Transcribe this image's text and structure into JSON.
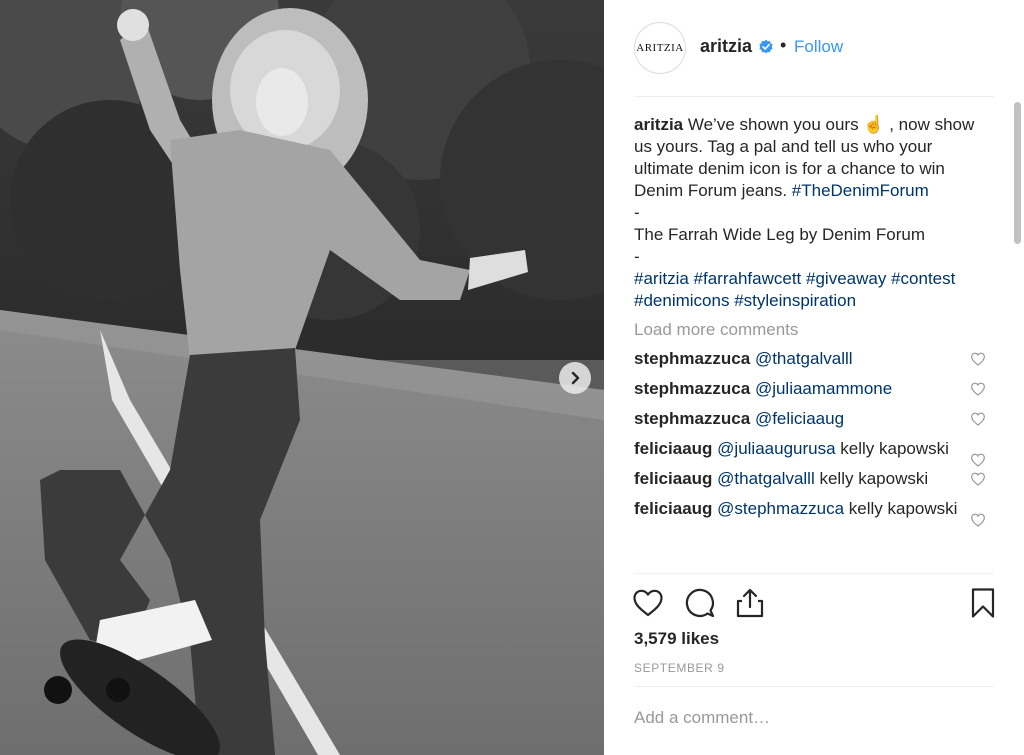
{
  "post": {
    "account": {
      "avatar_text": "ARITZIA",
      "handle": "aritzia",
      "verified_icon": "verified-badge-icon",
      "separator": "•",
      "follow_label": "Follow"
    },
    "caption": {
      "user": "aritzia",
      "line1": " We’ve shown you ours ",
      "emoji": "☝️",
      "line1_end": " , now show us yours. Tag a pal and tell us who your ultimate denim icon is for a chance to win Denim Forum jeans. ",
      "tag1": "#TheDenimForum",
      "dash1": "-",
      "product": "The Farrah Wide Leg by Denim Forum",
      "dash2": "-",
      "tags": [
        "#aritzia",
        "#farrahfawcett",
        "#giveaway",
        "#contest",
        "#denimicons",
        "#styleinspiration"
      ]
    },
    "load_more_label": "Load more comments",
    "comments": [
      {
        "user": "stephmazzuca",
        "mention": "@thatgalvalll",
        "text": ""
      },
      {
        "user": "stephmazzuca",
        "mention": "@juliaamammone",
        "text": ""
      },
      {
        "user": "stephmazzuca",
        "mention": "@feliciaaug",
        "text": ""
      },
      {
        "user": "feliciaaug",
        "mention": "@juliaaugurusa",
        "text": " kelly kapowski"
      },
      {
        "user": "feliciaaug",
        "mention": "@thatgalvalll",
        "text": " kelly kapowski"
      },
      {
        "user": "feliciaaug",
        "mention": "@stephmazzuca",
        "text": " kelly kapowski"
      }
    ],
    "actions": {
      "like_icon": "heart-icon",
      "comment_icon": "comment-icon",
      "share_icon": "share-icon",
      "save_icon": "bookmark-icon"
    },
    "likes": "3,579 likes",
    "date": "SEPTEMBER 9",
    "add_comment_placeholder": "Add a comment…"
  },
  "colors": {
    "link": "#3897f0",
    "hashtag": "#003569",
    "muted": "#999999",
    "text": "#262626"
  }
}
